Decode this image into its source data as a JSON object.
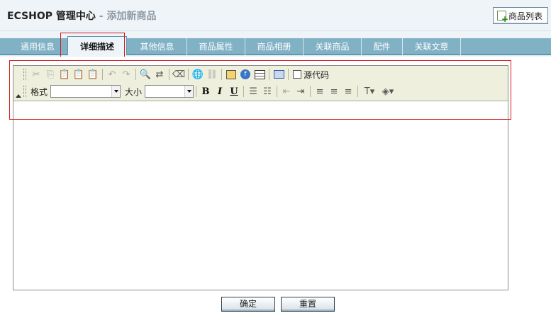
{
  "header": {
    "title": "ECSHOP 管理中心",
    "subtitle": " - 添加新商品",
    "action_button": "商品列表"
  },
  "tabs": [
    {
      "label": "通用信息",
      "active": false
    },
    {
      "label": "详细描述",
      "active": true
    },
    {
      "label": "其他信息",
      "active": false
    },
    {
      "label": "商品属性",
      "active": false
    },
    {
      "label": "商品相册",
      "active": false
    },
    {
      "label": "关联商品",
      "active": false
    },
    {
      "label": "配件",
      "active": false
    },
    {
      "label": "关联文章",
      "active": false
    }
  ],
  "editor": {
    "toolbar": {
      "source_label": "源代码",
      "format_label": "格式",
      "format_value": "",
      "size_label": "大小",
      "size_value": "",
      "bold_glyph": "B",
      "italic_glyph": "I",
      "underline_glyph": "U"
    },
    "content": ""
  },
  "buttons": {
    "confirm": "确定",
    "reset": "重置"
  },
  "colors": {
    "tab_bar": "#80b1c5",
    "highlight": "#d71a1a",
    "toolbar_bg": "#efefde"
  }
}
